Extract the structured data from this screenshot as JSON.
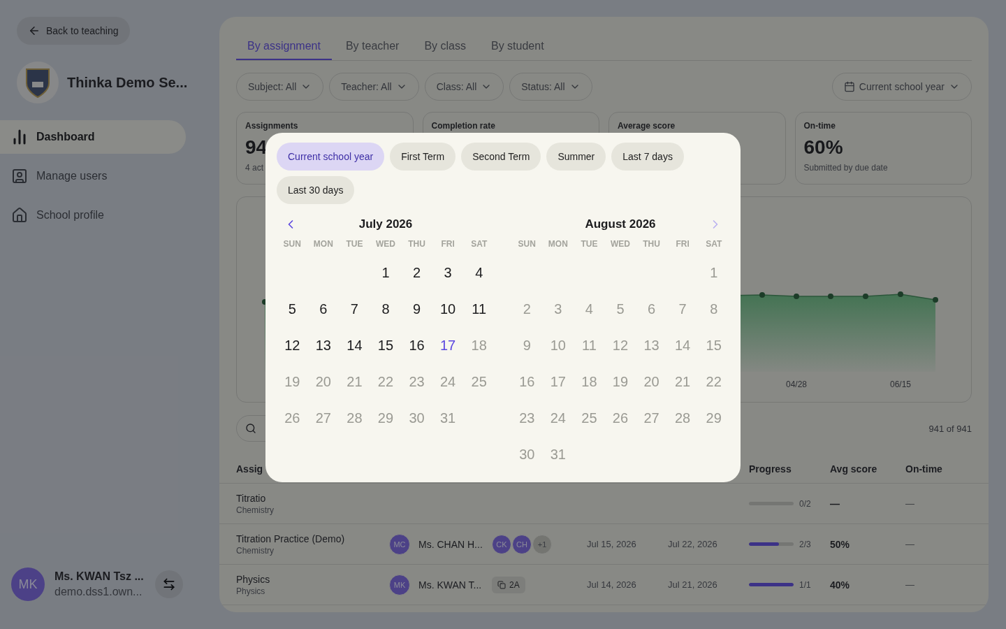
{
  "sidebar": {
    "back_button": "Back to teaching",
    "school_name": "Thinka Demo Se...",
    "nav": [
      {
        "label": "Dashboard",
        "selected": true
      },
      {
        "label": "Manage users",
        "selected": false
      },
      {
        "label": "School profile",
        "selected": false
      }
    ],
    "user": {
      "initials": "MK",
      "name": "Ms. KWAN Tsz ...",
      "email": "demo.dss1.own..."
    }
  },
  "tabs": [
    {
      "label": "By assignment",
      "selected": true
    },
    {
      "label": "By teacher",
      "selected": false
    },
    {
      "label": "By class",
      "selected": false
    },
    {
      "label": "By student",
      "selected": false
    }
  ],
  "filters": [
    {
      "label": "Subject:",
      "value": "All"
    },
    {
      "label": "Teacher:",
      "value": "All"
    },
    {
      "label": "Class:",
      "value": "All"
    },
    {
      "label": "Status:",
      "value": "All"
    }
  ],
  "date_filter": "Current school year",
  "stat_cards": [
    {
      "label": "Assignments",
      "value": "94",
      "note": "4 act"
    },
    {
      "label": "Completion rate"
    },
    {
      "label": "Average score"
    },
    {
      "label": "On-time",
      "value": "60%",
      "note": "Submitted by due date"
    }
  ],
  "chart": {
    "x_labels": [
      "04/28",
      "06/15"
    ]
  },
  "results_count": "941 of 941",
  "table": {
    "columns": {
      "assignment": "Assig",
      "progress": "Progress",
      "avg_score": "Avg score",
      "on_time": "On-time"
    },
    "rows": [
      {
        "title": "Titratio",
        "subject": "Chemistry",
        "progress": {
          "level": 0,
          "text": "0/2"
        },
        "avg_score": "—",
        "on_time": "—"
      },
      {
        "title": "Titration Practice (Demo)",
        "subject": "Chemistry",
        "teacher": {
          "initials": "MC",
          "name": "Ms. CHAN H..."
        },
        "classes": [
          {
            "kind": "avatar",
            "text": "CK"
          },
          {
            "kind": "avatar",
            "text": "CH"
          },
          {
            "kind": "more",
            "text": "+1"
          }
        ],
        "start": "Jul 15, 2026",
        "due": "Jul 22, 2026",
        "progress": {
          "level": 0.67,
          "text": "2/3"
        },
        "avg_score": "50%",
        "on_time": "—"
      },
      {
        "title": "Physics",
        "subject": "Physics",
        "teacher": {
          "initials": "MK",
          "name": "Ms. KWAN T..."
        },
        "classes": [
          {
            "kind": "chip",
            "text": "2A"
          }
        ],
        "start": "Jul 14, 2026",
        "due": "Jul 21, 2026",
        "progress": {
          "level": 1,
          "text": "1/1"
        },
        "avg_score": "40%",
        "on_time": "—"
      }
    ]
  },
  "date_picker": {
    "presets": [
      {
        "label": "Current school year",
        "selected": true
      },
      {
        "label": "First Term",
        "selected": false
      },
      {
        "label": "Second Term",
        "selected": false
      },
      {
        "label": "Summer",
        "selected": false
      },
      {
        "label": "Last 7 days",
        "selected": false
      },
      {
        "label": "Last 30 days",
        "selected": false
      }
    ],
    "prev_disabled": false,
    "next_disabled": true,
    "months": [
      {
        "title": "July 2026",
        "weekdays": [
          "SUN",
          "MON",
          "TUE",
          "WED",
          "THU",
          "FRI",
          "SAT"
        ],
        "weeks": [
          {
            "kind": "first",
            "days": [
              {
                "d": "1",
                "today": false,
                "disabled": false
              },
              {
                "d": "2",
                "today": false,
                "disabled": false
              },
              {
                "d": "3",
                "today": false,
                "disabled": false
              },
              {
                "d": "4",
                "today": false,
                "disabled": false
              }
            ]
          },
          {
            "kind": "week",
            "days": [
              {
                "d": "5",
                "today": false,
                "disabled": false
              },
              {
                "d": "6",
                "today": false,
                "disabled": false
              },
              {
                "d": "7",
                "today": false,
                "disabled": false
              },
              {
                "d": "8",
                "today": false,
                "disabled": false
              },
              {
                "d": "9",
                "today": false,
                "disabled": false
              },
              {
                "d": "10",
                "today": false,
                "disabled": false
              },
              {
                "d": "11",
                "today": false,
                "disabled": false
              }
            ]
          },
          {
            "kind": "week",
            "days": [
              {
                "d": "12",
                "today": false,
                "disabled": false
              },
              {
                "d": "13",
                "today": false,
                "disabled": false
              },
              {
                "d": "14",
                "today": false,
                "disabled": false
              },
              {
                "d": "15",
                "today": false,
                "disabled": false
              },
              {
                "d": "16",
                "today": false,
                "disabled": false
              },
              {
                "d": "17",
                "today": true,
                "disabled": false
              },
              {
                "d": "18",
                "today": false,
                "disabled": true
              }
            ]
          },
          {
            "kind": "week",
            "days": [
              {
                "d": "19",
                "today": false,
                "disabled": true
              },
              {
                "d": "20",
                "today": false,
                "disabled": true
              },
              {
                "d": "21",
                "today": false,
                "disabled": true
              },
              {
                "d": "22",
                "today": false,
                "disabled": true
              },
              {
                "d": "23",
                "today": false,
                "disabled": true
              },
              {
                "d": "24",
                "today": false,
                "disabled": true
              },
              {
                "d": "25",
                "today": false,
                "disabled": true
              }
            ]
          },
          {
            "kind": "week",
            "days": [
              {
                "d": "26",
                "today": false,
                "disabled": true
              },
              {
                "d": "27",
                "today": false,
                "disabled": true
              },
              {
                "d": "28",
                "today": false,
                "disabled": true
              },
              {
                "d": "29",
                "today": false,
                "disabled": true
              },
              {
                "d": "30",
                "today": false,
                "disabled": true
              },
              {
                "d": "31",
                "today": false,
                "disabled": true
              }
            ]
          }
        ]
      },
      {
        "title": "August 2026",
        "weekdays": [
          "SUN",
          "MON",
          "TUE",
          "WED",
          "THU",
          "FRI",
          "SAT"
        ],
        "weeks": [
          {
            "kind": "first",
            "days": [
              {
                "d": "1",
                "today": false,
                "disabled": true
              }
            ]
          },
          {
            "kind": "week",
            "days": [
              {
                "d": "2",
                "today": false,
                "disabled": true
              },
              {
                "d": "3",
                "today": false,
                "disabled": true
              },
              {
                "d": "4",
                "today": false,
                "disabled": true
              },
              {
                "d": "5",
                "today": false,
                "disabled": true
              },
              {
                "d": "6",
                "today": false,
                "disabled": true
              },
              {
                "d": "7",
                "today": false,
                "disabled": true
              },
              {
                "d": "8",
                "today": false,
                "disabled": true
              }
            ]
          },
          {
            "kind": "week",
            "days": [
              {
                "d": "9",
                "today": false,
                "disabled": true
              },
              {
                "d": "10",
                "today": false,
                "disabled": true
              },
              {
                "d": "11",
                "today": false,
                "disabled": true
              },
              {
                "d": "12",
                "today": false,
                "disabled": true
              },
              {
                "d": "13",
                "today": false,
                "disabled": true
              },
              {
                "d": "14",
                "today": false,
                "disabled": true
              },
              {
                "d": "15",
                "today": false,
                "disabled": true
              }
            ]
          },
          {
            "kind": "week",
            "days": [
              {
                "d": "16",
                "today": false,
                "disabled": true
              },
              {
                "d": "17",
                "today": false,
                "disabled": true
              },
              {
                "d": "18",
                "today": false,
                "disabled": true
              },
              {
                "d": "19",
                "today": false,
                "disabled": true
              },
              {
                "d": "20",
                "today": false,
                "disabled": true
              },
              {
                "d": "21",
                "today": false,
                "disabled": true
              },
              {
                "d": "22",
                "today": false,
                "disabled": true
              }
            ]
          },
          {
            "kind": "week",
            "days": [
              {
                "d": "23",
                "today": false,
                "disabled": true
              },
              {
                "d": "24",
                "today": false,
                "disabled": true
              },
              {
                "d": "25",
                "today": false,
                "disabled": true
              },
              {
                "d": "26",
                "today": false,
                "disabled": true
              },
              {
                "d": "27",
                "today": false,
                "disabled": true
              },
              {
                "d": "28",
                "today": false,
                "disabled": true
              },
              {
                "d": "29",
                "today": false,
                "disabled": true
              }
            ]
          },
          {
            "kind": "week",
            "days": [
              {
                "d": "30",
                "today": false,
                "disabled": true
              },
              {
                "d": "31",
                "today": false,
                "disabled": true
              }
            ]
          }
        ]
      }
    ]
  }
}
